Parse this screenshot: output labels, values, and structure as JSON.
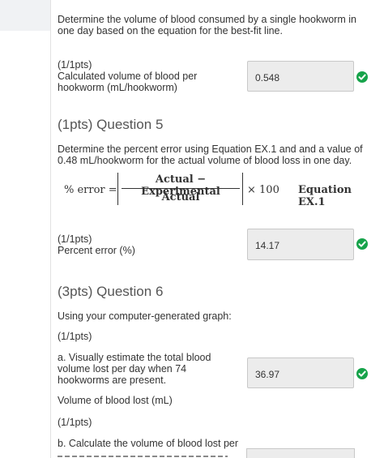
{
  "intro_text": "Determine the volume of blood consumed by a single hookworm in one day based on the equation for the best-fit line.",
  "q4_points": "(1/1pts)",
  "q4_label": "Calculated volume of blood per hookworm (mL/hookworm)",
  "q4_value": "0.548",
  "q5_title": "(1pts) Question 5",
  "q5_prompt": "Determine the percent error using Equation EX.1 and and a value of 0.48 mL/hookworm for the actual volume of blood loss in one day.",
  "equation": {
    "lhs": "% error =",
    "numerator": "Actual − Experimental",
    "denominator": "Actual",
    "tail": "× 100",
    "tag": "Equation EX.1"
  },
  "q5_points": "(1/1pts)",
  "q5_label": "Percent error (%)",
  "q5_value": "14.17",
  "q6_title": "(3pts) Question 6",
  "q6_prompt": "Using your computer-generated graph:",
  "q6_points_a": "(1/1pts)",
  "q6_a_label": "a. Visually estimate the total blood volume lost per day when 74 hookworms are present.",
  "q6_a_value": "36.97",
  "q6_a_unit": "Volume of blood lost (mL)",
  "q6_points_b": "(1/1pts)",
  "q6_b_label": "b. Calculate the volume of blood lost per",
  "status_color": "#16a34a"
}
